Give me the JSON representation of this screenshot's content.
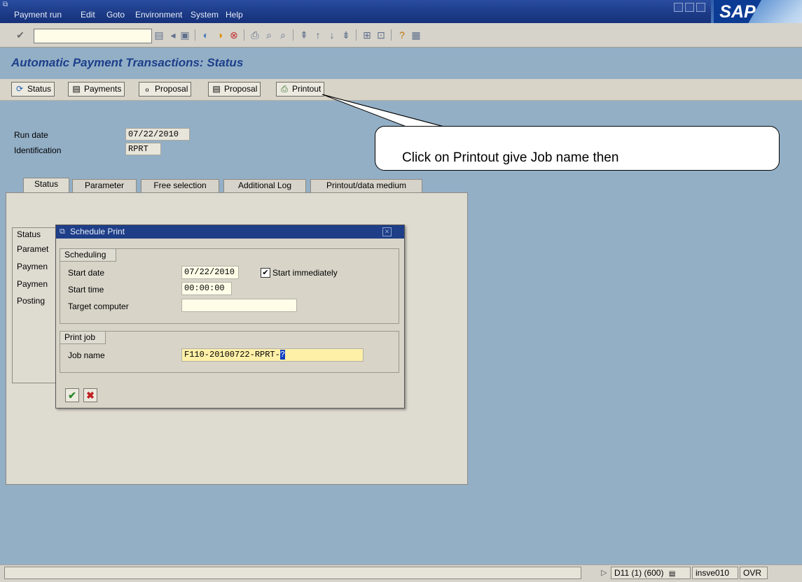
{
  "menu": {
    "items": [
      "Payment run",
      "Edit",
      "Goto",
      "Environment",
      "System",
      "Help"
    ],
    "logo_text": "SAP"
  },
  "page": {
    "title": "Automatic Payment Transactions: Status"
  },
  "app_toolbar": {
    "buttons": [
      "Status",
      "Payments",
      "Proposal",
      "Proposal",
      "Printout"
    ]
  },
  "header_fields": {
    "run_date_label": "Run date",
    "run_date_value": "07/22/2010",
    "identification_label": "Identification",
    "identification_value": "RPRT"
  },
  "callout": {
    "text": "Click on Printout give Job name then"
  },
  "tabs": [
    "Status",
    "Parameter",
    "Free selection",
    "Additional Log",
    "Printout/data medium"
  ],
  "status_panel": {
    "header": "Status",
    "rows": [
      "Paramet",
      "Paymen",
      "Paymen",
      "Posting"
    ]
  },
  "dialog": {
    "title": "Schedule Print",
    "scheduling": {
      "title": "Scheduling",
      "start_date_label": "Start date",
      "start_date_value": "07/22/2010",
      "start_immediately_label": "Start immediately",
      "start_immediately_checked": true,
      "start_time_label": "Start time",
      "start_time_value": "00:00:00",
      "target_computer_label": "Target computer",
      "target_computer_value": ""
    },
    "print_job": {
      "title": "Print job",
      "job_name_label": "Job name",
      "job_name_value": "F110-20100722-RPRT-",
      "job_name_cursor": "?"
    }
  },
  "status_bar": {
    "system": "D11 (1) (600)",
    "server": "insve010",
    "mode": "OVR"
  },
  "colors": {
    "title_bar": "#1e3e88",
    "page_title": "#1d3f8a",
    "background": "#93afc6"
  }
}
